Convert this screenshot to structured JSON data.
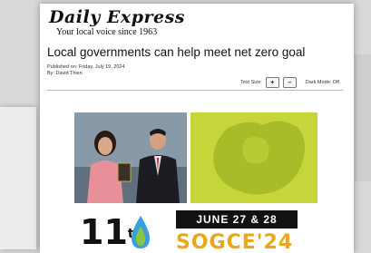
{
  "masthead": {
    "brand": "Daily Express",
    "tagline": "Your local voice since 1963"
  },
  "article": {
    "headline": "Local governments can help meet net zero goal",
    "published": "Published on: Friday, July 19, 2024",
    "byline": "By: David Thien"
  },
  "controls": {
    "text_size_label": "Text Size:",
    "increase_label": "+",
    "decrease_label": "–",
    "dark_mode_label": "Dark Mode: Off"
  },
  "figure": {
    "event_number": "11",
    "event_suffix": "th",
    "event_dates": "JUNE 27 & 28",
    "event_name": "SOGCE'24"
  },
  "colors": {
    "map_green": "#c6d63a",
    "event_orange": "#e9a81c",
    "date_box": "#111111"
  }
}
